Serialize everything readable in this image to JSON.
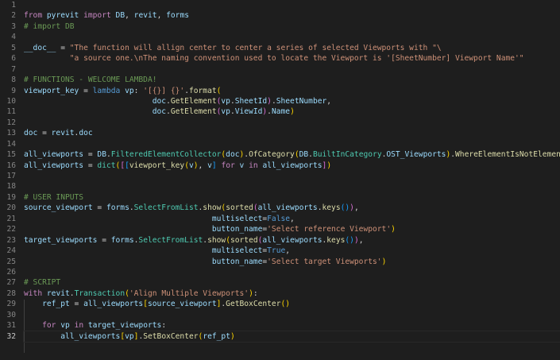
{
  "editor": {
    "active_line": 32,
    "line_numbers": [
      "1",
      "2",
      "3",
      "4",
      "5",
      "6",
      "7",
      "8",
      "9",
      "10",
      "11",
      "12",
      "13",
      "14",
      "15",
      "16",
      "17",
      "18",
      "19",
      "20",
      "21",
      "22",
      "23",
      "24",
      "25",
      "26",
      "27",
      "28",
      "29",
      "30",
      "31",
      "32"
    ],
    "lines": [
      [],
      [
        [
          "kw",
          "from"
        ],
        [
          "op",
          " "
        ],
        [
          "var",
          "pyrevit"
        ],
        [
          "op",
          " "
        ],
        [
          "kw",
          "import"
        ],
        [
          "op",
          " "
        ],
        [
          "var",
          "DB"
        ],
        [
          "op",
          ", "
        ],
        [
          "var",
          "revit"
        ],
        [
          "op",
          ", "
        ],
        [
          "var",
          "forms"
        ]
      ],
      [
        [
          "cmt",
          "# import DB"
        ]
      ],
      [],
      [
        [
          "var",
          "__doc__"
        ],
        [
          "op",
          " = "
        ],
        [
          "str",
          "\"The function will allign center to center a series of selected Viewports with \"\\"
        ]
      ],
      [
        [
          "op",
          "          "
        ],
        [
          "str",
          "\"a source one.\\nThe naming convention used to locate the Viewport is '[SheetNumber] Viewport Name'\""
        ]
      ],
      [],
      [
        [
          "cmt",
          "# FUNCTIONS - WELCOME LAMBDA!"
        ]
      ],
      [
        [
          "var",
          "viewport_key"
        ],
        [
          "op",
          " = "
        ],
        [
          "kw2",
          "lambda"
        ],
        [
          "op",
          " "
        ],
        [
          "var",
          "vp"
        ],
        [
          "op",
          ": "
        ],
        [
          "str",
          "'[{}] {}'"
        ],
        [
          "op",
          "."
        ],
        [
          "fn",
          "format"
        ],
        [
          "br1",
          "("
        ]
      ],
      [
        [
          "op",
          "                            "
        ],
        [
          "var",
          "doc"
        ],
        [
          "op",
          "."
        ],
        [
          "fn",
          "GetElement"
        ],
        [
          "br2",
          "("
        ],
        [
          "var",
          "vp"
        ],
        [
          "op",
          "."
        ],
        [
          "var",
          "SheetId"
        ],
        [
          "br2",
          ")"
        ],
        [
          "op",
          "."
        ],
        [
          "var",
          "SheetNumber"
        ],
        [
          "op",
          ","
        ]
      ],
      [
        [
          "op",
          "                            "
        ],
        [
          "var",
          "doc"
        ],
        [
          "op",
          "."
        ],
        [
          "fn",
          "GetElement"
        ],
        [
          "br2",
          "("
        ],
        [
          "var",
          "vp"
        ],
        [
          "op",
          "."
        ],
        [
          "var",
          "ViewId"
        ],
        [
          "br2",
          ")"
        ],
        [
          "op",
          "."
        ],
        [
          "var",
          "Name"
        ],
        [
          "br1",
          ")"
        ]
      ],
      [],
      [
        [
          "var",
          "doc"
        ],
        [
          "op",
          " = "
        ],
        [
          "var",
          "revit"
        ],
        [
          "op",
          "."
        ],
        [
          "var",
          "doc"
        ]
      ],
      [],
      [
        [
          "var",
          "all_viewports"
        ],
        [
          "op",
          " = "
        ],
        [
          "var",
          "DB"
        ],
        [
          "op",
          "."
        ],
        [
          "cls",
          "FilteredElementCollector"
        ],
        [
          "br1",
          "("
        ],
        [
          "var",
          "doc"
        ],
        [
          "br1",
          ")"
        ],
        [
          "op",
          "."
        ],
        [
          "fn",
          "OfCategory"
        ],
        [
          "br1",
          "("
        ],
        [
          "var",
          "DB"
        ],
        [
          "op",
          "."
        ],
        [
          "cls",
          "BuiltInCategory"
        ],
        [
          "op",
          "."
        ],
        [
          "var",
          "OST_Viewports"
        ],
        [
          "br1",
          ")"
        ],
        [
          "op",
          "."
        ],
        [
          "fn",
          "WhereElementIsNotElementType"
        ],
        [
          "br1",
          "("
        ],
        [
          "br1",
          ")"
        ]
      ],
      [
        [
          "var",
          "all_viewports"
        ],
        [
          "op",
          " = "
        ],
        [
          "cls",
          "dict"
        ],
        [
          "br1",
          "("
        ],
        [
          "br2",
          "["
        ],
        [
          "br3",
          "["
        ],
        [
          "fn",
          "viewport_key"
        ],
        [
          "br1",
          "("
        ],
        [
          "var",
          "v"
        ],
        [
          "br1",
          ")"
        ],
        [
          "op",
          ", "
        ],
        [
          "var",
          "v"
        ],
        [
          "br3",
          "]"
        ],
        [
          "op",
          " "
        ],
        [
          "kw",
          "for"
        ],
        [
          "op",
          " "
        ],
        [
          "var",
          "v"
        ],
        [
          "op",
          " "
        ],
        [
          "kw",
          "in"
        ],
        [
          "op",
          " "
        ],
        [
          "var",
          "all_viewports"
        ],
        [
          "br2",
          "]"
        ],
        [
          "br1",
          ")"
        ]
      ],
      [],
      [],
      [
        [
          "cmt",
          "# USER INPUTS"
        ]
      ],
      [
        [
          "var",
          "source_viewport"
        ],
        [
          "op",
          " = "
        ],
        [
          "var",
          "forms"
        ],
        [
          "op",
          "."
        ],
        [
          "cls",
          "SelectFromList"
        ],
        [
          "op",
          "."
        ],
        [
          "fn",
          "show"
        ],
        [
          "br1",
          "("
        ],
        [
          "fn",
          "sorted"
        ],
        [
          "br2",
          "("
        ],
        [
          "var",
          "all_viewports"
        ],
        [
          "op",
          "."
        ],
        [
          "fn",
          "keys"
        ],
        [
          "br3",
          "("
        ],
        [
          "br3",
          ")"
        ],
        [
          "br2",
          ")"
        ],
        [
          "op",
          ","
        ]
      ],
      [
        [
          "op",
          "                                         "
        ],
        [
          "var",
          "multiselect"
        ],
        [
          "op",
          "="
        ],
        [
          "const",
          "False"
        ],
        [
          "op",
          ","
        ]
      ],
      [
        [
          "op",
          "                                         "
        ],
        [
          "var",
          "button_name"
        ],
        [
          "op",
          "="
        ],
        [
          "str",
          "'Select reference Viewport'"
        ],
        [
          "br1",
          ")"
        ]
      ],
      [
        [
          "var",
          "target_viewports"
        ],
        [
          "op",
          " = "
        ],
        [
          "var",
          "forms"
        ],
        [
          "op",
          "."
        ],
        [
          "cls",
          "SelectFromList"
        ],
        [
          "op",
          "."
        ],
        [
          "fn",
          "show"
        ],
        [
          "br1",
          "("
        ],
        [
          "fn",
          "sorted"
        ],
        [
          "br2",
          "("
        ],
        [
          "var",
          "all_viewports"
        ],
        [
          "op",
          "."
        ],
        [
          "fn",
          "keys"
        ],
        [
          "br3",
          "("
        ],
        [
          "br3",
          ")"
        ],
        [
          "br2",
          ")"
        ],
        [
          "op",
          ","
        ]
      ],
      [
        [
          "op",
          "                                         "
        ],
        [
          "var",
          "multiselect"
        ],
        [
          "op",
          "="
        ],
        [
          "const",
          "True"
        ],
        [
          "op",
          ","
        ]
      ],
      [
        [
          "op",
          "                                         "
        ],
        [
          "var",
          "button_name"
        ],
        [
          "op",
          "="
        ],
        [
          "str",
          "'Select target Viewports'"
        ],
        [
          "br1",
          ")"
        ]
      ],
      [],
      [
        [
          "cmt",
          "# SCRIPT"
        ]
      ],
      [
        [
          "kw",
          "with"
        ],
        [
          "op",
          " "
        ],
        [
          "var",
          "revit"
        ],
        [
          "op",
          "."
        ],
        [
          "cls",
          "Transaction"
        ],
        [
          "br1",
          "("
        ],
        [
          "str",
          "'Align Multiple Viewports'"
        ],
        [
          "br1",
          ")"
        ],
        [
          "op",
          ":"
        ]
      ],
      [
        [
          "op",
          "    "
        ],
        [
          "var",
          "ref_pt"
        ],
        [
          "op",
          " = "
        ],
        [
          "var",
          "all_viewports"
        ],
        [
          "br1",
          "["
        ],
        [
          "var",
          "source_viewport"
        ],
        [
          "br1",
          "]"
        ],
        [
          "op",
          "."
        ],
        [
          "fn",
          "GetBoxCenter"
        ],
        [
          "br1",
          "("
        ],
        [
          "br1",
          ")"
        ]
      ],
      [],
      [
        [
          "op",
          "    "
        ],
        [
          "kw",
          "for"
        ],
        [
          "op",
          " "
        ],
        [
          "var",
          "vp"
        ],
        [
          "op",
          " "
        ],
        [
          "kw",
          "in"
        ],
        [
          "op",
          " "
        ],
        [
          "var",
          "target_viewports"
        ],
        [
          "op",
          ":"
        ]
      ],
      [
        [
          "op",
          "        "
        ],
        [
          "var",
          "all_viewports"
        ],
        [
          "br1",
          "["
        ],
        [
          "var",
          "vp"
        ],
        [
          "br1",
          "]"
        ],
        [
          "op",
          "."
        ],
        [
          "fn",
          "SetBoxCenter"
        ],
        [
          "br1",
          "("
        ],
        [
          "var",
          "ref_pt"
        ],
        [
          "br1",
          ")"
        ]
      ]
    ]
  }
}
